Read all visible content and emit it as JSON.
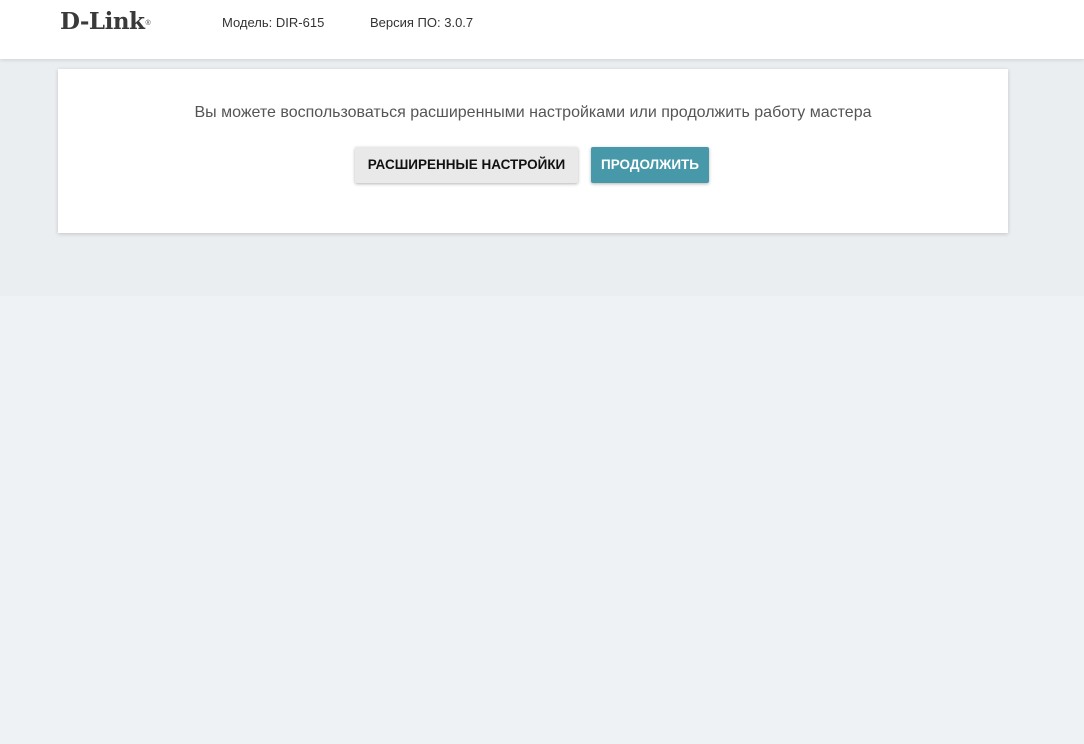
{
  "header": {
    "logo_text": "D-Link",
    "logo_mark": "®",
    "model": "Модель: DIR-615",
    "firmware": "Версия ПО: 3.0.7"
  },
  "wizard": {
    "message": "Вы можете воспользоваться расширенными настройками или продолжить работу мастера",
    "advanced_label": "РАСШИРЕННЫЕ НАСТРОЙКИ",
    "continue_label": "ПРОДОЛЖИТЬ"
  },
  "colors": {
    "primary_button": "#4799a9",
    "secondary_button": "#e9e9e9",
    "page_background": "#eff2f5"
  }
}
